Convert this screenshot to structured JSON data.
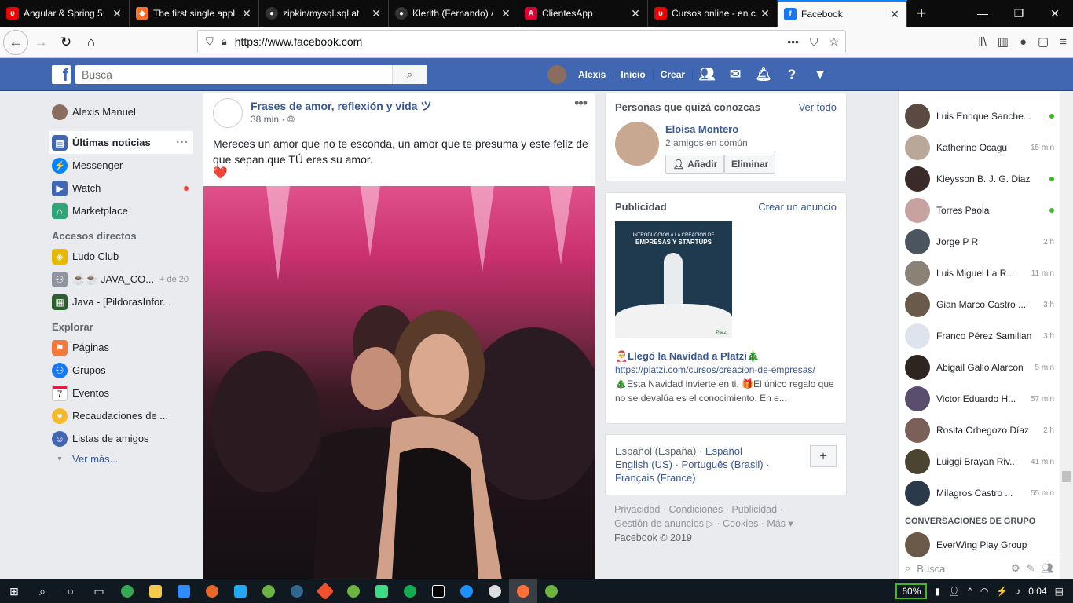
{
  "browser": {
    "tabs": [
      {
        "title": "Angular & Spring 5:",
        "icon_color": "#e00"
      },
      {
        "title": "The first single appl",
        "icon_color": "#fc6d26"
      },
      {
        "title": "zipkin/mysql.sql at",
        "icon_color": "#333"
      },
      {
        "title": "Klerith (Fernando) /",
        "icon_color": "#333"
      },
      {
        "title": "ClientesApp",
        "icon_color": "#dd0031"
      },
      {
        "title": "Cursos online - en c",
        "icon_color": "#e00"
      },
      {
        "title": "Facebook",
        "icon_color": "#1877f2"
      }
    ],
    "url": "https://www.facebook.com",
    "icons": [
      "back-icon",
      "forward-icon",
      "reload-icon",
      "home-icon",
      "lock-icon",
      "more-icon",
      "pocket-icon",
      "star-icon",
      "library-icon",
      "sidebar-icon",
      "account-icon",
      "extension-icon",
      "menu-icon"
    ]
  },
  "fb": {
    "search_placeholder": "Busca",
    "user": "Alexis",
    "nav_home": "Inicio",
    "nav_create": "Crear"
  },
  "left": {
    "profile": "Alexis Manuel",
    "items": [
      {
        "label": "Últimas noticias",
        "icon": "news-feed-icon",
        "color": "#4267b2"
      },
      {
        "label": "Messenger",
        "icon": "messenger-icon",
        "color": "#0084ff"
      },
      {
        "label": "Watch",
        "icon": "watch-icon",
        "color": "#4267b2"
      },
      {
        "label": "Marketplace",
        "icon": "marketplace-icon",
        "color": "#2fa677"
      }
    ],
    "shortcuts_title": "Accesos directos",
    "shortcuts": [
      {
        "label": "Ludo Club",
        "icon": "ludo-icon",
        "color": "#e6b800"
      },
      {
        "label": "☕☕ JAVA_CO...",
        "badge": "+ de 20",
        "icon": "group-icon",
        "color": "#90949c"
      },
      {
        "label": "Java - [PildorasInfor...",
        "icon": "page-icon",
        "color": "#2c5f2d"
      }
    ],
    "explore_title": "Explorar",
    "explore": [
      {
        "label": "Páginas",
        "icon": "flag-icon",
        "color": "#f5793a"
      },
      {
        "label": "Grupos",
        "icon": "groups-icon",
        "color": "#1877f2"
      },
      {
        "label": "Eventos",
        "icon": "calendar-icon",
        "color": "#e41e3f"
      },
      {
        "label": "Recaudaciones de ...",
        "icon": "fundraiser-icon",
        "color": "#f7b928"
      },
      {
        "label": "Listas de amigos",
        "icon": "friends-list-icon",
        "color": "#4267b2"
      }
    ],
    "see_more": "Ver más..."
  },
  "post": {
    "page": "Frases de amor, reflexión y vida ツ",
    "time": "38 min",
    "text": "Mereces un amor que no te esconda, un amor que te presuma y este feliz de que sepan que TÚ eres su amor.",
    "heart": "❤️"
  },
  "pymk": {
    "title": "Personas que quizá conozcas",
    "see_all": "Ver todo",
    "name": "Eloisa Montero",
    "mutual": "2 amigos en común",
    "add": "Añadir",
    "remove": "Eliminar"
  },
  "ad": {
    "title": "Publicidad",
    "create": "Crear un anuncio",
    "img_line1": "INTRODUCCIÓN A LA CREACIÓN DE",
    "img_line2": "EMPRESAS Y STARTUPS",
    "img_brand": "Platzi",
    "headline": "🎅Llegó la Navidad a Platzi🎄",
    "url": "https://platzi.com/cursos/creacion-de-empresas/",
    "desc": "🎄Esta Navidad invierte en ti. 🎁El único regalo que no se devalúa es el conocimiento. En e..."
  },
  "lang": {
    "current": "Español (España)",
    "l1": "Español",
    "l2": "English (US)",
    "l3": "Português (Brasil)",
    "l4": "Français (France)"
  },
  "footer": {
    "line1": "Privacidad · Condiciones · Publicidad ·",
    "line2": "Gestión de anuncios ▷ · Cookies · Más ▾",
    "copy": "Facebook © 2019"
  },
  "chat": {
    "contacts": [
      {
        "name": "Luis Enrique Sanche...",
        "status": "online",
        "color": "#5a4a42"
      },
      {
        "name": "Katherine Ocagu",
        "status": "15 min",
        "color": "#b9a79a"
      },
      {
        "name": "Kleysson B. J. G. Diaz",
        "status": "online",
        "color": "#3a2a2a"
      },
      {
        "name": "Torres Paola",
        "status": "online",
        "color": "#c6a2a0"
      },
      {
        "name": "Jorge P R",
        "status": "2 h",
        "color": "#4b5560"
      },
      {
        "name": "Luis Miguel La R...",
        "status": "11 min",
        "color": "#8a8276"
      },
      {
        "name": "Gian Marco Castro ...",
        "status": "3 h",
        "color": "#6a5a4a"
      },
      {
        "name": "Franco Pérez Samillan",
        "status": "3 h",
        "color": "#dfe3ee"
      },
      {
        "name": "Abigail Gallo Alarcon",
        "status": "5 min",
        "color": "#2e2420"
      },
      {
        "name": "Victor Eduardo H...",
        "status": "57 min",
        "color": "#5a4e6e"
      },
      {
        "name": "Rosita Orbegozo Díaz",
        "status": "2 h",
        "color": "#7a6058"
      },
      {
        "name": "Luiggi Brayan Riv...",
        "status": "41 min",
        "color": "#4a4430"
      },
      {
        "name": "Milagros Castro ...",
        "status": "55 min",
        "color": "#2a3a4a"
      }
    ],
    "group_title": "CONVERSACIONES DE GRUPO",
    "group": "EverWing Play Group",
    "search": "Busca"
  },
  "taskbar": {
    "battery": "60%",
    "time": "0:04"
  }
}
